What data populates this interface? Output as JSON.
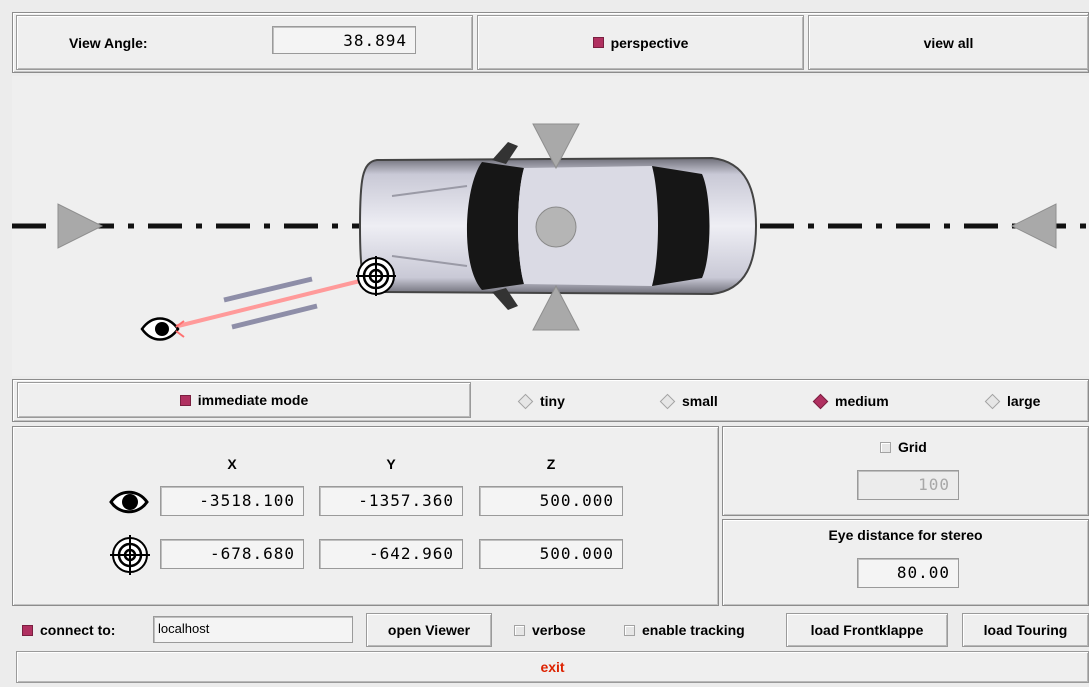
{
  "top": {
    "view_angle_label": "View Angle:",
    "view_angle_value": "38.894",
    "perspective_label": "perspective",
    "perspective_checked": true,
    "view_all_label": "view all"
  },
  "canvas": {
    "accent_color": "#b03060"
  },
  "mode_row": {
    "immediate_label": "immediate mode",
    "immediate_checked": true,
    "sizes": [
      {
        "label": "tiny",
        "selected": false
      },
      {
        "label": "small",
        "selected": false
      },
      {
        "label": "medium",
        "selected": true
      },
      {
        "label": "large",
        "selected": false
      }
    ]
  },
  "coords": {
    "headers": [
      "X",
      "Y",
      "Z"
    ],
    "eye": [
      "-3518.100",
      "-1357.360",
      "500.000"
    ],
    "target": [
      "-678.680",
      "-642.960",
      "500.000"
    ]
  },
  "grid": {
    "label": "Grid",
    "checked": false,
    "value": "100"
  },
  "stereo": {
    "label": "Eye distance for stereo",
    "value": "80.00"
  },
  "bottom": {
    "connect_label": "connect to:",
    "connect_checked": true,
    "host_value": "localhost",
    "open_viewer_label": "open Viewer",
    "verbose_label": "verbose",
    "tracking_label": "enable tracking",
    "load_front_label": "load Frontklappe",
    "load_touring_label": "load Touring",
    "exit_label": "exit",
    "exit_color": "#dd2200"
  }
}
